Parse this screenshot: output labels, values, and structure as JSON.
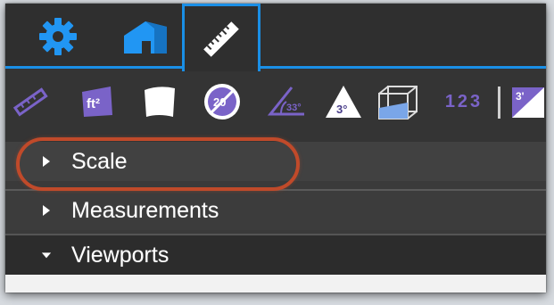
{
  "tabs": [
    {
      "name": "settings",
      "icon": "gear-icon"
    },
    {
      "name": "layout",
      "icon": "building-icon"
    },
    {
      "name": "measure",
      "icon": "ruler-icon",
      "active": true
    }
  ],
  "toolbar": {
    "tools": [
      {
        "icon": "ruler-diagonal-icon"
      },
      {
        "icon": "area-sqft-icon",
        "text": "ft²"
      },
      {
        "icon": "shape-icon"
      },
      {
        "icon": "diameter-circle-icon",
        "text": "20"
      },
      {
        "icon": "angle-icon",
        "text": "33°"
      },
      {
        "icon": "triangle-angle-icon",
        "text": "3°"
      },
      {
        "icon": "cube-volume-icon"
      },
      {
        "icon": "count-icon",
        "text": "123"
      },
      {
        "icon": "dimension-icon",
        "text": "3'"
      }
    ]
  },
  "panel": {
    "rows": [
      {
        "label": "Scale",
        "expanded": false
      },
      {
        "label": "Measurements",
        "expanded": false
      },
      {
        "label": "Viewports",
        "expanded": true
      }
    ]
  },
  "colors": {
    "accent": "#1a8fe6",
    "tool": "#7a63c8",
    "highlight": "#c04a2a"
  }
}
